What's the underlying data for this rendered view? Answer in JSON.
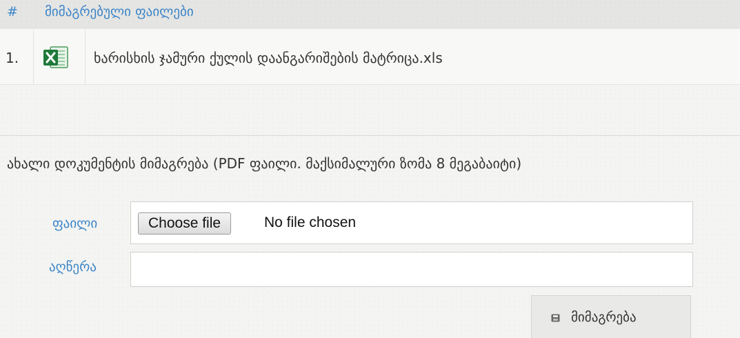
{
  "files_table": {
    "header_hash": "#",
    "header_title": "მიმაგრებული ფაილები",
    "rows": [
      {
        "number": "1.",
        "icon": "excel-file-icon",
        "file_name": "ხარისხის ჯამური ქულის დაანგარიშების მატრიცა.xls"
      }
    ]
  },
  "upload": {
    "heading": "ახალი დოკუმენტის მიმაგრება (PDF ფაილი. მაქსიმალური ზომა 8 მეგაბაიტი)",
    "file_label": "ფაილი",
    "choose_file_button": "Choose file",
    "no_file_text": "No file chosen",
    "description_label": "აღწერა",
    "description_value": "",
    "submit_label": "მიმაგრება",
    "submit_icon": "save-icon"
  },
  "colors": {
    "link_blue": "#3a84c8",
    "excel_green": "#1f7a3a"
  }
}
